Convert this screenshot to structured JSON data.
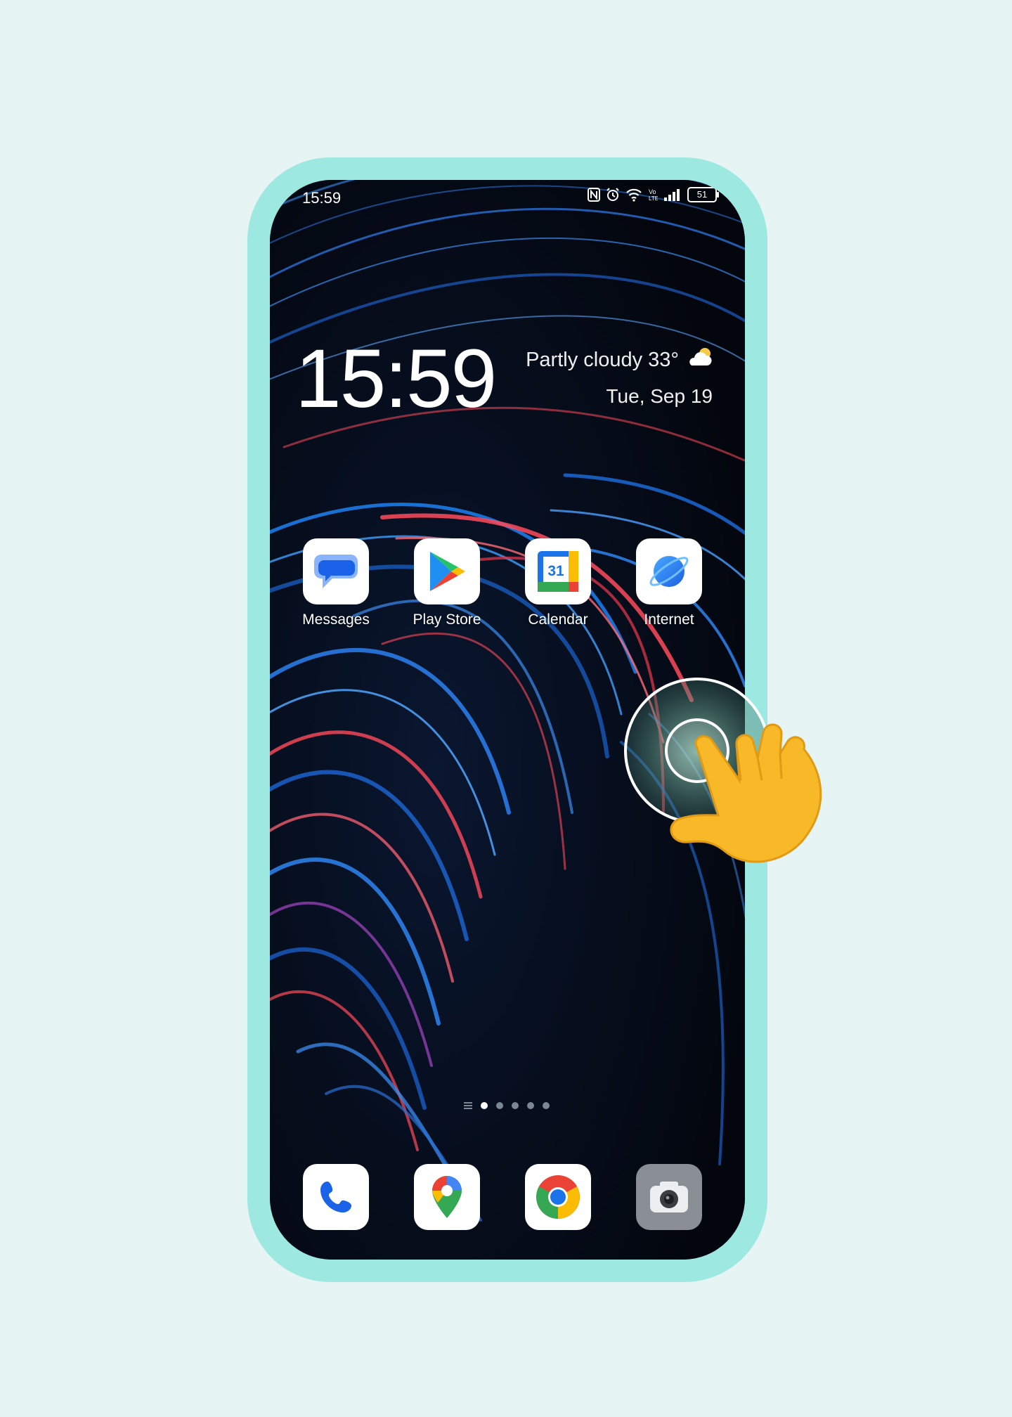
{
  "status_bar": {
    "time": "15:59",
    "icons": [
      "nfc-icon",
      "alarm-icon",
      "wifi-icon",
      "volte-icon",
      "signal-icon"
    ],
    "battery": "51"
  },
  "clock_widget": {
    "time": "15:59",
    "weather": "Partly cloudy 33°",
    "weather_icon": "partly-cloudy-icon",
    "date": "Tue, Sep 19"
  },
  "apps": [
    {
      "label": "Messages",
      "icon": "messages-icon"
    },
    {
      "label": "Play Store",
      "icon": "play-store-icon"
    },
    {
      "label": "Calendar",
      "icon": "calendar-icon",
      "icon_text": "31"
    },
    {
      "label": "Internet",
      "icon": "internet-icon"
    }
  ],
  "dock": [
    {
      "icon": "phone-icon"
    },
    {
      "icon": "maps-icon"
    },
    {
      "icon": "chrome-icon"
    },
    {
      "icon": "camera-icon"
    }
  ],
  "page_indicator": {
    "pages": 5,
    "active": 1
  },
  "colors": {
    "background": "#e6f5f4",
    "frame": "#9ee8e2",
    "wallpaper_dark": "#050a14",
    "accent_blue": "#1e88ff",
    "accent_red": "#ff4a5a"
  }
}
